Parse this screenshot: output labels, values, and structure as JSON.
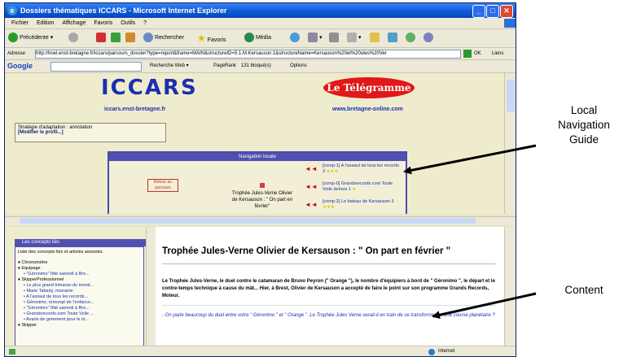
{
  "window": {
    "title": "Dossiers thématiques ICCARS - Microsoft Internet Explorer"
  },
  "menu": [
    "Fichier",
    "Edition",
    "Affichage",
    "Favoris",
    "Outils",
    "?"
  ],
  "toolbar": {
    "back": "Précédente",
    "search": "Rechercher",
    "favorites": "Favoris",
    "media": "Média"
  },
  "address": {
    "label": "Adresse",
    "url": "http://hoel.enst-bretagne.fr/iccars/parcours_dossier?type=report&frame=MAIN&structureID=5.1.M.Kersauson.1&structureName=Kersauson%20et%20ules%20Ver",
    "go": "OK",
    "links": "Liens"
  },
  "googlebar": {
    "brand": "Google",
    "search": "Recherche Web",
    "pagerank": "PageRank",
    "blocked": "131 bloqué(s)",
    "options": "Options"
  },
  "header": {
    "iccars": "ICCARS",
    "iccars_url": "iccars.enst-bretagne.fr",
    "telegramme": "Le Télégramme",
    "telegramme_url": "www.bretagne-online.com"
  },
  "strategy": {
    "text": "Stratégie d'adaptation : annotation",
    "link": "[Modifier le profil...]"
  },
  "navigation": {
    "header": "Navigation locale",
    "retour": "Retour au parcours",
    "current": "Trophée Jules-Verne Olivier de Kersauson : \" On part en février\"",
    "items": [
      {
        "text": "[comp-1] A l'assaut de tous les records 3 ",
        "stars": "★★★"
      },
      {
        "text": "[comp-0] Grandsrecords.com Toute Voile dehors 1 ",
        "stars": "★"
      },
      {
        "text": "[comp-2] Le bateau de Kersauson 3 ",
        "stars": "★★★"
      }
    ]
  },
  "concepts": {
    "header": "Les concepts liés",
    "intro": "Liste des concepts liés et articles associés.",
    "items": [
      {
        "t": "Chronométre",
        "sub": false
      },
      {
        "t": "Equipage",
        "sub": false
      },
      {
        "t": "\"Géronimo\" fêté samedi à Bre...",
        "sub": true
      },
      {
        "t": "SkipperProfessionnel",
        "sub": false
      },
      {
        "t": "Le plus grand trimaran du mond...",
        "sub": true
      },
      {
        "t": "Marie Tabarly, marraine",
        "sub": true
      },
      {
        "t": "A l'assaut de tous les records...",
        "sub": true
      },
      {
        "t": "Géronimo, remorqé de l'enfance...",
        "sub": true
      },
      {
        "t": "\"Géronimo\" fêté samedi à Bre...",
        "sub": true
      },
      {
        "t": "Grandsrecords.com Toute Voile ...",
        "sub": true
      },
      {
        "t": "Avarie de gréement pour le tri...",
        "sub": true
      },
      {
        "t": "Skipper",
        "sub": false
      }
    ]
  },
  "article": {
    "title": "Trophée Jules-Verne Olivier de Kersauson : \" On part en février \"",
    "lead": "Le Trophée Jules-Verne, le duel contre le catamaran de Bruno Peyron (\" Orange \"), le nombre d'équipiers à bord de \" Géronimo \", le départ et le contre-temps technique à cause du mât... Hier, à Brest, Olivier de Kersauson a accepté de faire le point sur son programme Grands Records, Moteur.",
    "quote": "- On parle beaucoup du duel entre votre \" Géronimo \" et \" Orange \". Le Trophée Jules Verne serait-il en train de se transformer en une course planétaire ?"
  },
  "status": {
    "zone": "Internet"
  },
  "annotations": {
    "nav": [
      "Local",
      "Navigation",
      "Guide"
    ],
    "content": "Content"
  }
}
